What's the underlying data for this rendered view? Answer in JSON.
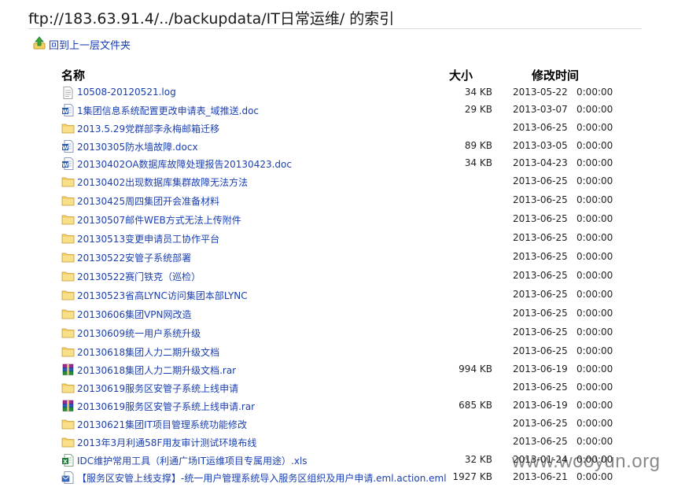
{
  "page": {
    "title": "ftp://183.63.91.4/../backupdata/IT日常运维/ 的索引",
    "up_link_label": "回到上一层文件夹"
  },
  "columns": {
    "name": "名称",
    "size": "大小",
    "modified": "修改时间"
  },
  "files": [
    {
      "name": "10508-20120521.log",
      "size": "34 KB",
      "date": "2013-05-22",
      "time": "0:00:00",
      "icon": "text-file-icon"
    },
    {
      "name": "1集团信息系统配置更改申请表_域推送.doc",
      "size": "29 KB",
      "date": "2013-03-07",
      "time": "0:00:00",
      "icon": "word-doc-icon"
    },
    {
      "name": "2013.5.29党群部李永梅邮箱迁移",
      "size": "",
      "date": "2013-06-25",
      "time": "0:00:00",
      "icon": "folder-icon"
    },
    {
      "name": "20130305防水墙故障.docx",
      "size": "89 KB",
      "date": "2013-03-05",
      "time": "0:00:00",
      "icon": "word-doc-icon"
    },
    {
      "name": "20130402OA数据库故障处理报告20130423.doc",
      "size": "34 KB",
      "date": "2013-04-23",
      "time": "0:00:00",
      "icon": "word-doc-icon"
    },
    {
      "name": "20130402出现数据库集群故障无法方法",
      "size": "",
      "date": "2013-06-25",
      "time": "0:00:00",
      "icon": "folder-icon"
    },
    {
      "name": "20130425周四集团开会准备材料",
      "size": "",
      "date": "2013-06-25",
      "time": "0:00:00",
      "icon": "folder-icon"
    },
    {
      "name": "20130507邮件WEB方式无法上传附件",
      "size": "",
      "date": "2013-06-25",
      "time": "0:00:00",
      "icon": "folder-icon"
    },
    {
      "name": "20130513变更申请员工协作平台",
      "size": "",
      "date": "2013-06-25",
      "time": "0:00:00",
      "icon": "folder-icon"
    },
    {
      "name": "20130522安管子系统部署",
      "size": "",
      "date": "2013-06-25",
      "time": "0:00:00",
      "icon": "folder-icon"
    },
    {
      "name": "20130522赛门铁克（巡检）",
      "size": "",
      "date": "2013-06-25",
      "time": "0:00:00",
      "icon": "folder-icon"
    },
    {
      "name": "20130523省高LYNC访问集团本部LYNC",
      "size": "",
      "date": "2013-06-25",
      "time": "0:00:00",
      "icon": "folder-icon"
    },
    {
      "name": "20130606集团VPN网改造",
      "size": "",
      "date": "2013-06-25",
      "time": "0:00:00",
      "icon": "folder-icon"
    },
    {
      "name": "20130609统一用户系统升级",
      "size": "",
      "date": "2013-06-25",
      "time": "0:00:00",
      "icon": "folder-icon"
    },
    {
      "name": "20130618集团人力二期升级文档",
      "size": "",
      "date": "2013-06-25",
      "time": "0:00:00",
      "icon": "folder-icon"
    },
    {
      "name": "20130618集团人力二期升级文档.rar",
      "size": "994 KB",
      "date": "2013-06-19",
      "time": "0:00:00",
      "icon": "rar-archive-icon"
    },
    {
      "name": "20130619服务区安管子系统上线申请",
      "size": "",
      "date": "2013-06-25",
      "time": "0:00:00",
      "icon": "folder-icon"
    },
    {
      "name": "20130619服务区安管子系统上线申请.rar",
      "size": "685 KB",
      "date": "2013-06-19",
      "time": "0:00:00",
      "icon": "rar-archive-icon"
    },
    {
      "name": "20130621集团IT项目管理系统功能修改",
      "size": "",
      "date": "2013-06-25",
      "time": "0:00:00",
      "icon": "folder-icon"
    },
    {
      "name": "2013年3月利通58F用友审计测试环境布线",
      "size": "",
      "date": "2013-06-25",
      "time": "0:00:00",
      "icon": "folder-icon"
    },
    {
      "name": "IDC维护常用工具（利通广场IT运维项目专属用途）.xls",
      "size": "32 KB",
      "date": "2013-01-24",
      "time": "0:00:00",
      "icon": "excel-xls-icon"
    },
    {
      "name": "【服务区安管上线支撑】-统一用户管理系统导入服务区组织及用户申请.eml.action.eml",
      "size": "1927 KB",
      "date": "2013-06-21",
      "time": "0:00:00",
      "icon": "email-file-icon"
    }
  ],
  "watermark": "www.wooyun.org"
}
